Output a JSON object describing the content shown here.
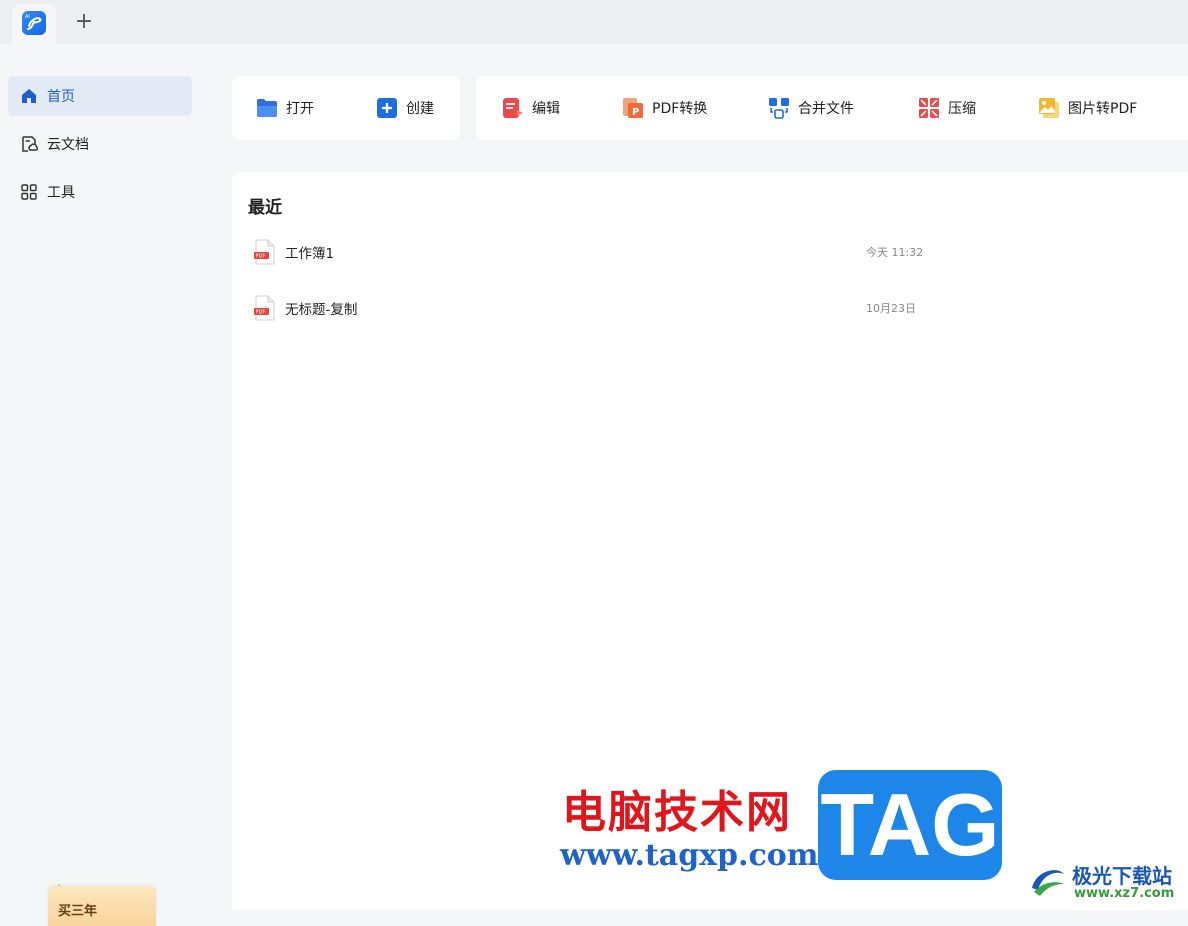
{
  "titlebar": {
    "new_tab_label": "+"
  },
  "sidebar": {
    "items": [
      {
        "label": "首页",
        "icon": "home-icon",
        "active": true
      },
      {
        "label": "云文档",
        "icon": "cloud-doc-icon",
        "active": false
      },
      {
        "label": "工具",
        "icon": "grid-tools-icon",
        "active": false
      }
    ],
    "promo_label": "买三年"
  },
  "actions": {
    "open_label": "打开",
    "create_label": "创建",
    "edit_label": "编辑",
    "pdf_convert_label": "PDF转换",
    "merge_label": "合并文件",
    "compress_label": "压缩",
    "image_to_pdf_label": "图片转PDF"
  },
  "recent": {
    "title": "最近",
    "files": [
      {
        "name": "工作簿1",
        "time": "今天 11:32",
        "icon": "pdf-file-icon"
      },
      {
        "name": "无标题-复制",
        "time": "10月23日",
        "icon": "pdf-file-icon"
      }
    ]
  },
  "watermark": {
    "site_cn": "电脑技术网",
    "site_url": "www.tagxp.com",
    "tag": "TAG",
    "site2_cn": "极光下载站",
    "site2_url": "www.xz7.com"
  },
  "colors": {
    "accent": "#1b5fd1",
    "active_bg": "#e3eaf5",
    "pdf_red": "#e2463d"
  }
}
